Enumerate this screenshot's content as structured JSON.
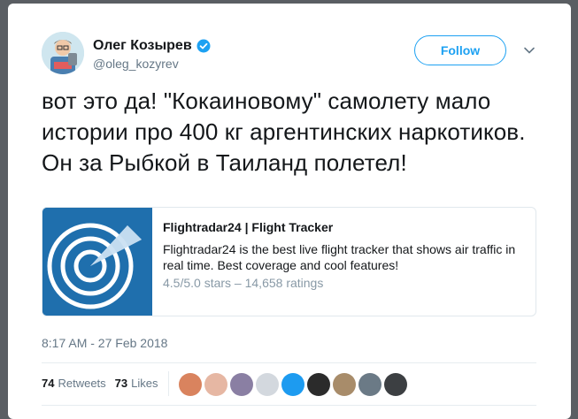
{
  "author": {
    "name": "Олег Козырев",
    "handle": "@oleg_kozyrev",
    "verified_icon": "verified-badge-icon"
  },
  "follow_label": "Follow",
  "tweet_text": "вот это да! \"Кокаиновому\" самолету мало истории про 400 кг аргентинских наркотиков. Он за Рыбкой в Таиланд полетел!",
  "link_card": {
    "title": "Flightradar24 | Flight Tracker",
    "description": "Flightradar24 is the best live flight tracker that shows air traffic in real time. Best coverage and cool features!",
    "rating": "4.5/5.0 stars – 14,658 ratings",
    "thumbnail_icon": "radar-icon"
  },
  "timestamp": "8:17 AM - 27 Feb 2018",
  "stats": {
    "retweets_count": "74",
    "retweets_label": "Retweets",
    "likes_count": "73",
    "likes_label": "Likes"
  },
  "liker_avatars": [
    {
      "color": "#d9835e"
    },
    {
      "color": "#e6b7a3"
    },
    {
      "color": "#8a7fa3"
    },
    {
      "color": "#d3d8de"
    },
    {
      "color": "#1d9bf0"
    },
    {
      "color": "#2b2b2b"
    },
    {
      "color": "#a88c6a"
    },
    {
      "color": "#6b7a86"
    },
    {
      "color": "#3c3f42"
    }
  ],
  "colors": {
    "accent": "#1da1f2",
    "text": "#14171a",
    "secondary": "#657786",
    "radar_bg": "#1f6fad"
  }
}
